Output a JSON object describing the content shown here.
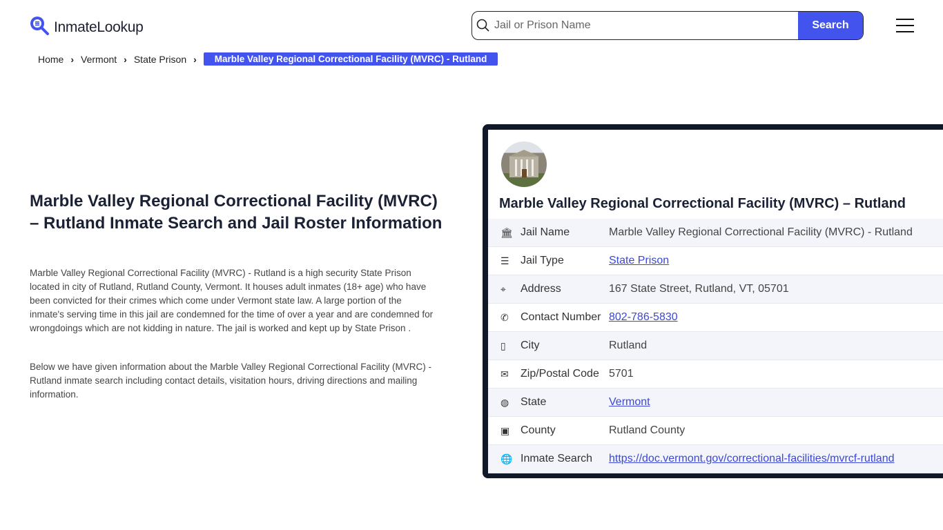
{
  "header": {
    "logo_text": "InmateLookup",
    "search_placeholder": "Jail or Prison Name",
    "search_button": "Search"
  },
  "breadcrumb": [
    "Home",
    "Vermont",
    "State Prison",
    "Marble Valley Regional Correctional Facility (MVRC) - Rutland"
  ],
  "main": {
    "title": "Marble Valley Regional Correctional Facility (MVRC) – Rutland Inmate Search and Jail Roster Information",
    "paragraph1": "Marble Valley Regional Correctional Facility (MVRC) - Rutland is a high security State Prison located in city of Rutland, Rutland County, Vermont. It houses adult inmates (18+ age) who have been convicted for their crimes which come under Vermont state law. A large portion of the inmate's serving time in this jail are condemned for the time of over a year and are condemned for wrongdoings which are not kidding in nature. The jail is worked and kept up by State Prison .",
    "paragraph2": "Below we have given information about the Marble Valley Regional Correctional Facility (MVRC) - Rutland inmate search including contact details, visitation hours, driving directions and mailing information."
  },
  "card": {
    "title": "Marble Valley Regional Correctional Facility (MVRC) – Rutland",
    "rows": [
      {
        "icon": "bank-icon",
        "label": "Jail Name",
        "value": "Marble Valley Regional Correctional Facility (MVRC) - Rutland",
        "link": false
      },
      {
        "icon": "list-icon",
        "label": "Jail Type",
        "value": "State Prison",
        "link": true
      },
      {
        "icon": "map-pin-icon",
        "label": "Address",
        "value": "167 State Street, Rutland, VT, 05701",
        "link": false
      },
      {
        "icon": "phone-icon",
        "label": "Contact Number",
        "value": "802-786-5830",
        "link": true
      },
      {
        "icon": "map-icon",
        "label": "City",
        "value": "Rutland",
        "link": false
      },
      {
        "icon": "mail-icon",
        "label": "Zip/Postal Code",
        "value": "5701",
        "link": false
      },
      {
        "icon": "globe-icon",
        "label": "State",
        "value": "Vermont",
        "link": true
      },
      {
        "icon": "county-icon",
        "label": "County",
        "value": "Rutland County",
        "link": false
      },
      {
        "icon": "world-icon",
        "label": "Inmate Search",
        "value": "https://doc.vermont.gov/correctional-facilities/mvrcf-rutland",
        "link": true
      }
    ]
  },
  "colors": {
    "accent": "#4353ee",
    "card_border": "#111827",
    "link": "#3b47d6"
  }
}
